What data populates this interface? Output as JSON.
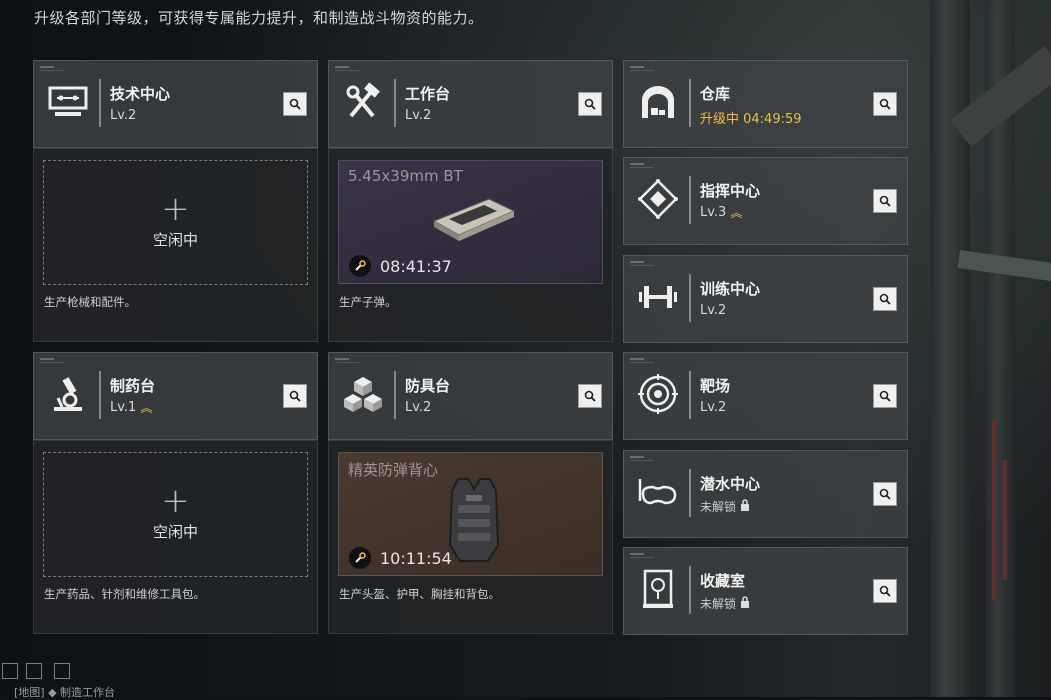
{
  "header": {
    "description": "升级各部门等级，可获得专属能力提升，和制造战斗物资的能力。"
  },
  "columns": {
    "left": [
      {
        "name": "技术中心",
        "level": "Lv.2",
        "icon": "computer-icon",
        "status": "idle",
        "idle_label": "空闲中",
        "description": "生产枪械和配件。"
      },
      {
        "name": "制药台",
        "level": "Lv.1",
        "icon": "microscope-icon",
        "upgradable": true,
        "status": "idle",
        "idle_label": "空闲中",
        "description": "生产药品、针剂和维修工具包。"
      }
    ],
    "middle": [
      {
        "name": "工作台",
        "level": "Lv.2",
        "icon": "hammer-wrench-icon",
        "status": "producing",
        "product": "5.45x39mm BT",
        "timer": "08:41:37",
        "description": "生产子弹。"
      },
      {
        "name": "防具台",
        "level": "Lv.2",
        "icon": "cubes-icon",
        "status": "producing",
        "product": "精英防弹背心",
        "timer": "10:11:54",
        "description": "生产头盔、护甲、胸挂和背包。"
      }
    ],
    "right": [
      {
        "name": "仓库",
        "level": "升级中 04:49:59",
        "icon": "warehouse-icon",
        "upgrading": true
      },
      {
        "name": "指挥中心",
        "level": "Lv.3",
        "icon": "command-diamond-icon",
        "upgradable": true
      },
      {
        "name": "训练中心",
        "level": "Lv.2",
        "icon": "dumbbell-icon"
      },
      {
        "name": "靶场",
        "level": "Lv.2",
        "icon": "target-icon"
      },
      {
        "name": "潜水中心",
        "level": "未解锁",
        "icon": "diving-mask-icon",
        "locked": true
      },
      {
        "name": "收藏室",
        "level": "未解锁",
        "icon": "display-case-icon",
        "locked": true
      }
    ]
  },
  "colors": {
    "upgrade_yellow": "#f0c040",
    "card_bg": "#3c4042",
    "panel_bg": "#222527"
  },
  "footer": {
    "label": "[地图] ◆ 制造工作台"
  }
}
